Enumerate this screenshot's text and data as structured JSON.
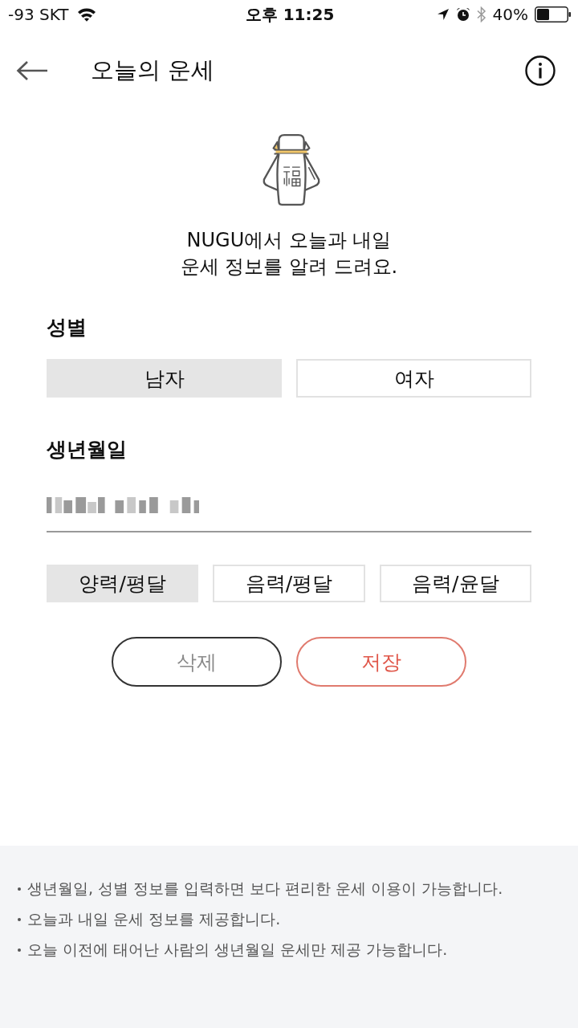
{
  "status_bar": {
    "carrier": "-93 SKT",
    "time": "오후 11:25",
    "battery": "40%"
  },
  "header": {
    "title": "오늘의 운세"
  },
  "intro": {
    "lines": [
      "NUGU에서 오늘과 내일",
      "운세 정보를 알려 드려요."
    ]
  },
  "gender": {
    "label": "성별",
    "options": [
      {
        "label": "남자",
        "selected": true
      },
      {
        "label": "여자",
        "selected": false
      }
    ]
  },
  "birthdate": {
    "label": "생년월일"
  },
  "calendar": {
    "options": [
      {
        "label": "양력/평달",
        "selected": true
      },
      {
        "label": "음력/평달",
        "selected": false
      },
      {
        "label": "음력/윤달",
        "selected": false
      }
    ]
  },
  "actions": [
    {
      "label": "삭제",
      "kind": "delete"
    },
    {
      "label": "저장",
      "kind": "save"
    }
  ],
  "notes": [
    "생년월일, 성별 정보를 입력하면 보다 편리한 운세 이용이 가능합니다.",
    "오늘과 내일 운세 정보를 제공합니다.",
    "오늘 이전에 태어난 사람의 생년월일 운세만 제공 가능합니다."
  ]
}
